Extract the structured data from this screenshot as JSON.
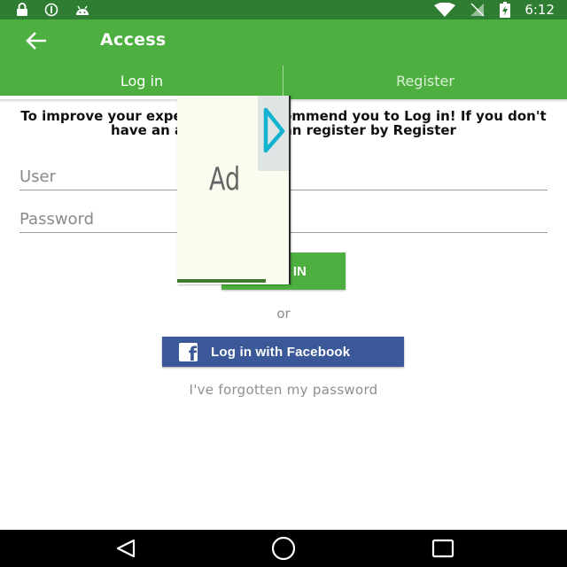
{
  "status_bar": {
    "time": "6:12",
    "icons": [
      "lock-icon",
      "info-icon",
      "android-icon",
      "wifi-icon",
      "no-signal-icon",
      "battery-charging-icon"
    ]
  },
  "app_bar": {
    "title": "Access",
    "back_icon": "arrow-left-icon"
  },
  "tabs": [
    {
      "label": "Log in",
      "active": true
    },
    {
      "label": "Register",
      "active": false
    }
  ],
  "intro_text": "To improve your experience we recommend you to Log in! If you don't have an account, you can register by Register",
  "form": {
    "user_placeholder": "User",
    "password_placeholder": "Password",
    "login_button": "LOG IN"
  },
  "or_text": "or",
  "facebook_button": "Log in with Facebook",
  "forgot_password": "I've forgotten my password",
  "ad": {
    "label": "Ad",
    "icon": "ad-play-icon"
  },
  "nav_bar": {
    "icons": [
      "back-triangle-icon",
      "home-circle-icon",
      "recents-square-icon"
    ]
  },
  "colors": {
    "primary": "#4caf3f",
    "status_bar": "#2e7d32",
    "facebook": "#3b5998"
  }
}
